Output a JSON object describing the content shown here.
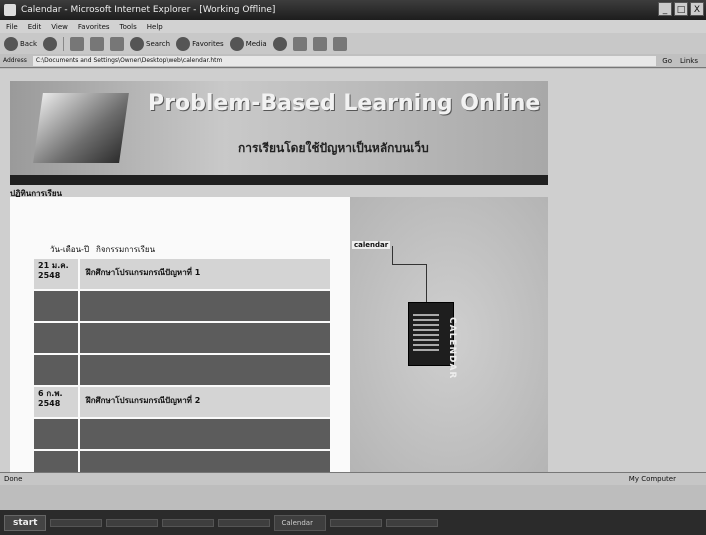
{
  "window": {
    "title": "Calendar - Microsoft Internet Explorer - [Working Offline]",
    "controls": [
      "_",
      "□",
      "X"
    ]
  },
  "menu": [
    "File",
    "Edit",
    "View",
    "Favorites",
    "Tools",
    "Help"
  ],
  "toolbar": {
    "back": "Back",
    "search": "Search",
    "favorites": "Favorites",
    "media": "Media"
  },
  "address": {
    "label": "Address",
    "url": "C:\\Documents and Settings\\Owner\\Desktop\\web\\calendar.htm",
    "go": "Go",
    "links": "Links"
  },
  "page": {
    "heading": "Problem-Based Learning Online",
    "thai_subtitle": "การเรียนโดยใช้ปัญหาเป็นหลักบนเว็บ",
    "breadcrumb": "ปฏิทินการเรียน",
    "table_header": {
      "date": "วัน-เดือน-ปี",
      "topic": "กิจกรรมการเรียน"
    },
    "rows": [
      {
        "date": "21 ม.ค. 2548",
        "topic": "ฝึกศึกษาโปรแกรมกรณีปัญหาที่ 1",
        "style": "light"
      },
      {
        "date": "",
        "topic": "",
        "style": "dark"
      },
      {
        "date": "",
        "topic": "",
        "style": "dark"
      },
      {
        "date": "",
        "topic": "",
        "style": "dark"
      },
      {
        "date": "6 ก.พ. 2548",
        "topic": "ฝึกศึกษาโปรแกรมกรณีปัญหาที่ 2",
        "style": "light"
      },
      {
        "date": "",
        "topic": "",
        "style": "dark"
      },
      {
        "date": "",
        "topic": "",
        "style": "dark"
      },
      {
        "date": "",
        "topic": "",
        "style": "dark"
      }
    ],
    "side_tag": "calendar",
    "calendar_label": "CALENDAR"
  },
  "status": {
    "left": "Done",
    "zone": "My Computer"
  },
  "taskbar": {
    "start": "start",
    "items": [
      "",
      "",
      "",
      "",
      "Calendar",
      "",
      ""
    ],
    "clock": ""
  }
}
